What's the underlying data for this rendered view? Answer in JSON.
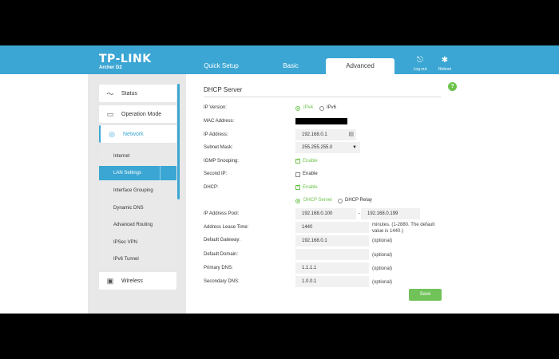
{
  "brand": {
    "logo": "TP-LINK",
    "model": "Archer D2"
  },
  "tabs": [
    {
      "label": "Quick Setup"
    },
    {
      "label": "Basic"
    },
    {
      "label": "Advanced"
    }
  ],
  "top_icons": [
    {
      "label": "Log out",
      "icon": "logout-icon"
    },
    {
      "label": "Reboot",
      "icon": "reboot-icon"
    }
  ],
  "sidebar": {
    "top_items": [
      {
        "label": "Status",
        "icon": "status-icon"
      },
      {
        "label": "Operation Mode",
        "icon": "monitor-icon"
      },
      {
        "label": "Network",
        "icon": "globe-icon"
      },
      {
        "label": "Wireless",
        "icon": "wireless-icon"
      }
    ],
    "sub_items": [
      {
        "label": "Internet"
      },
      {
        "label": "LAN Settings"
      },
      {
        "label": "Interface Grouping"
      },
      {
        "label": "Dynamic DNS"
      },
      {
        "label": "Advanced Routing"
      },
      {
        "label": "IPSec VPN"
      },
      {
        "label": "IPv6 Tunnel"
      }
    ]
  },
  "form": {
    "title": "DHCP Server",
    "help": "?",
    "ip_version": {
      "label": "IP Version:",
      "opt1": "IPv4",
      "opt2": "IPv6",
      "selected": "IPv4"
    },
    "mac": {
      "label": "MAC Address:"
    },
    "ip": {
      "label": "IP Address:",
      "value": "192.168.0.1"
    },
    "subnet": {
      "label": "Subnet Mask:",
      "value": "255.255.255.0"
    },
    "igmp": {
      "label": "IGMP Snooping:",
      "text": "Enable",
      "checked": true
    },
    "second_ip": {
      "label": "Second IP:",
      "text": "Enable",
      "checked": false
    },
    "dhcp": {
      "label": "DHCP:",
      "text": "Enable",
      "checked": true
    },
    "dhcp_mode": {
      "opt1": "DHCP Server",
      "opt2": "DHCP Relay",
      "selected": "DHCP Server"
    },
    "pool": {
      "label": "IP Address Pool:",
      "start": "192.168.0.100",
      "sep": "-",
      "end": "192.168.0.199"
    },
    "lease": {
      "label": "Address Lease Time:",
      "value": "1440",
      "note1": "minutes. (1-2880. The default",
      "note2": "value is 1440.)"
    },
    "gateway": {
      "label": "Default Gateway:",
      "value": "192.168.0.1",
      "note": "(optional)"
    },
    "domain": {
      "label": "Default Domain:",
      "value": "",
      "note": "(optional)"
    },
    "dns1": {
      "label": "Primary DNS:",
      "value": "1.1.1.1",
      "note": "(optional)"
    },
    "dns2": {
      "label": "Secondary DNS:",
      "value": "1.0.0.1",
      "note": "(optional)"
    },
    "save": "Save"
  },
  "colors": {
    "accent": "#3ba6d3",
    "green": "#6cc24a"
  }
}
